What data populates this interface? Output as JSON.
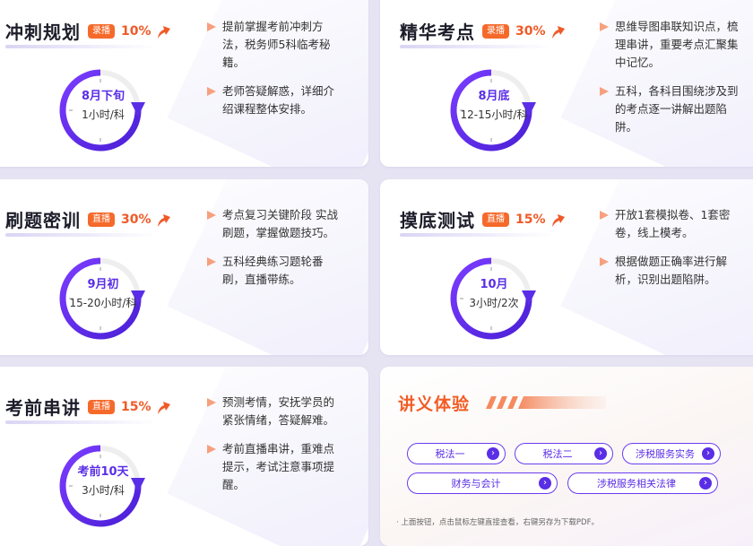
{
  "cards": [
    {
      "title": "冲刺规划",
      "badge": "录播",
      "pct": "10%",
      "dial_main": "8月下旬",
      "dial_sub": "1小时/科",
      "bullets": [
        "提前掌握考前冲刺方法，税务师5科临考秘籍。",
        "老师答疑解惑，详细介绍课程整体安排。"
      ]
    },
    {
      "title": "精华考点",
      "badge": "录播",
      "pct": "30%",
      "dial_main": "8月底",
      "dial_sub": "12-15小时/科",
      "bullets": [
        "思维导图串联知识点，梳理串讲，重要考点汇聚集中记忆。",
        "五科，各科目围绕涉及到的考点逐一讲解出题陷阱。"
      ]
    },
    {
      "title": "刷题密训",
      "badge": "直播",
      "pct": "30%",
      "dial_main": "9月初",
      "dial_sub": "15-20小时/科",
      "bullets": [
        "考点复习关键阶段 实战刷题，掌握做题技巧。",
        "五科经典练习题轮番刷，直播带练。"
      ]
    },
    {
      "title": "摸底测试",
      "badge": "直播",
      "pct": "15%",
      "dial_main": "10月",
      "dial_sub": "3小时/2次",
      "bullets": [
        "开放1套模拟卷、1套密卷，线上模考。",
        "根据做题正确率进行解析，识别出题陷阱。"
      ]
    },
    {
      "title": "考前串讲",
      "badge": "直播",
      "pct": "15%",
      "dial_main": "考前10天",
      "dial_sub": "3小时/科",
      "bullets": [
        "预测考情，安抚学员的紧张情绪，答疑解难。",
        "考前直播串讲，重难点提示，考试注意事项提醒。"
      ]
    }
  ],
  "handout": {
    "title": "讲义体验",
    "buttons": [
      "税法一",
      "税法二",
      "涉税服务实务",
      "财务与会计",
      "涉税服务相关法律"
    ],
    "note": "· 上面按钮，点击鼠标左键直接查看，右键另存为下载PDF。"
  },
  "colors": {
    "accent": "#5a2ee6",
    "orange": "#f05a28",
    "badge": "#f56a2b"
  },
  "icons": {
    "trend": "trend-up-arrow-icon",
    "bullet": "triangle-bullet-icon",
    "dial": "clock-dial-icon",
    "pill_arrow": "chevron-right-icon"
  }
}
